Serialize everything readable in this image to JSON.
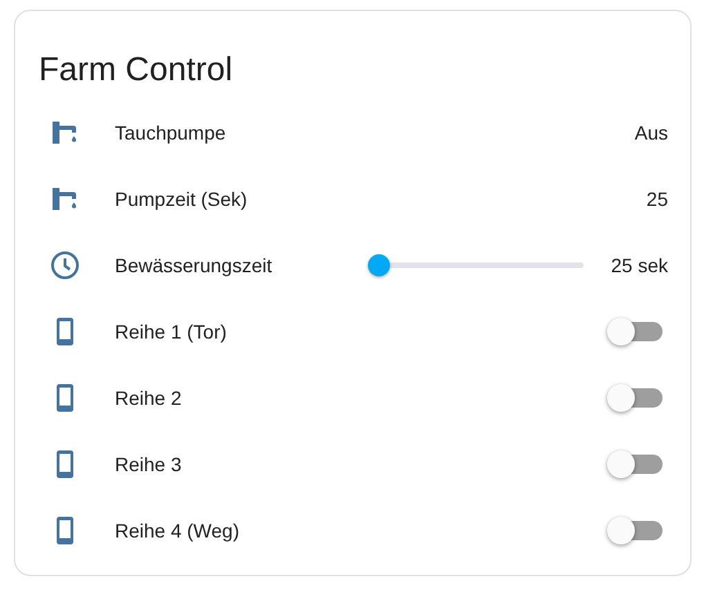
{
  "card": {
    "title": "Farm Control"
  },
  "rows": [
    {
      "kind": "text",
      "label": "Tauchpumpe",
      "value": "Aus"
    },
    {
      "kind": "text",
      "label": "Pumpzeit (Sek)",
      "value": "25"
    },
    {
      "kind": "slider",
      "label": "Bewässerungszeit",
      "level": 0,
      "value": "25 sek"
    },
    {
      "kind": "toggle",
      "label": "Reihe 1 (Tor)",
      "on": false
    },
    {
      "kind": "toggle",
      "label": "Reihe 2",
      "on": false
    },
    {
      "kind": "toggle",
      "label": "Reihe 3",
      "on": false
    },
    {
      "kind": "toggle",
      "label": "Reihe 4 (Weg)",
      "on": false
    }
  ]
}
